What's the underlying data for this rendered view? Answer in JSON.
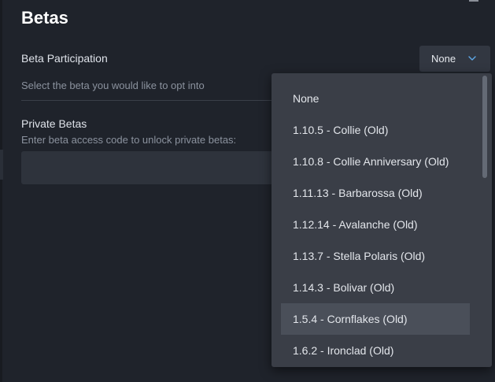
{
  "page": {
    "title": "Betas"
  },
  "beta_participation": {
    "label": "Beta Participation",
    "description": "Select the beta you would like to opt into",
    "selected_value": "None",
    "options": [
      "None",
      "1.10.5 - Collie (Old)",
      "1.10.8 - Collie Anniversary (Old)",
      "1.11.13 - Barbarossa (Old)",
      "1.12.14 - Avalanche (Old)",
      "1.13.7 - Stella Polaris (Old)",
      "1.14.3 - Bolivar (Old)",
      "1.5.4 - Cornflakes (Old)",
      "1.6.2 - Ironclad (Old)"
    ],
    "hovered_option": "1.5.4 - Cornflakes (Old)"
  },
  "private_betas": {
    "label": "Private Betas",
    "description": "Enter beta access code to unlock private betas:",
    "input_value": ""
  },
  "colors": {
    "background": "#1f232b",
    "dropdown_bg": "#3a3e47",
    "hover_bg": "#4a4f59",
    "chevron": "#5ea8e8"
  },
  "icons": {
    "select_chevron": "chevron-down-icon"
  }
}
